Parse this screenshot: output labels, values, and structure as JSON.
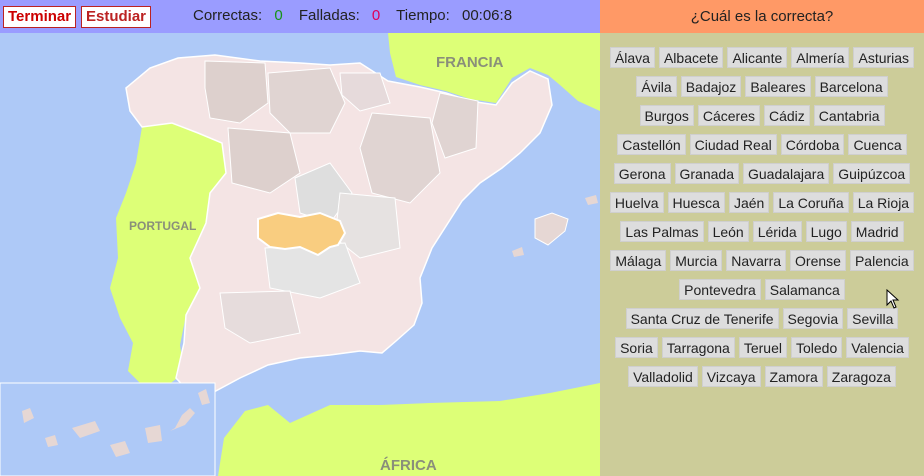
{
  "toolbar": {
    "finish_label": "Terminar",
    "study_label": "Estudiar",
    "correct_label": "Correctas:",
    "correct_value": "0",
    "failed_label": "Falladas:",
    "failed_value": "0",
    "time_label": "Tiempo:",
    "time_value": "00:06:8"
  },
  "question": "¿Cuál es la correcta?",
  "options": [
    "Álava",
    "Albacete",
    "Alicante",
    "Almería",
    "Asturias",
    "Ávila",
    "Badajoz",
    "Baleares",
    "Barcelona",
    "Burgos",
    "Cáceres",
    "Cádiz",
    "Cantabria",
    "Castellón",
    "Ciudad Real",
    "Córdoba",
    "Cuenca",
    "Gerona",
    "Granada",
    "Guadalajara",
    "Guipúzcoa",
    "Huelva",
    "Huesca",
    "Jaén",
    "La Coruña",
    "La Rioja",
    "Las Palmas",
    "León",
    "Lérida",
    "Lugo",
    "Madrid",
    "Málaga",
    "Murcia",
    "Navarra",
    "Orense",
    "Palencia",
    "Pontevedra",
    "Salamanca",
    "Santa Cruz de Tenerife",
    "Segovia",
    "Sevilla",
    "Soria",
    "Tarragona",
    "Teruel",
    "Toledo",
    "Valencia",
    "Valladolid",
    "Vizcaya",
    "Zamora",
    "Zaragoza"
  ],
  "map": {
    "labels": {
      "france": "FRANCIA",
      "portugal": "PORTUGAL",
      "africa": "ÁFRICA"
    },
    "highlighted_province_color": "#f9cd80",
    "sea_color": "#aec9f7",
    "foreign_land_color": "#ddff77"
  },
  "icons": {
    "cursor": "arrow-cursor-icon"
  }
}
